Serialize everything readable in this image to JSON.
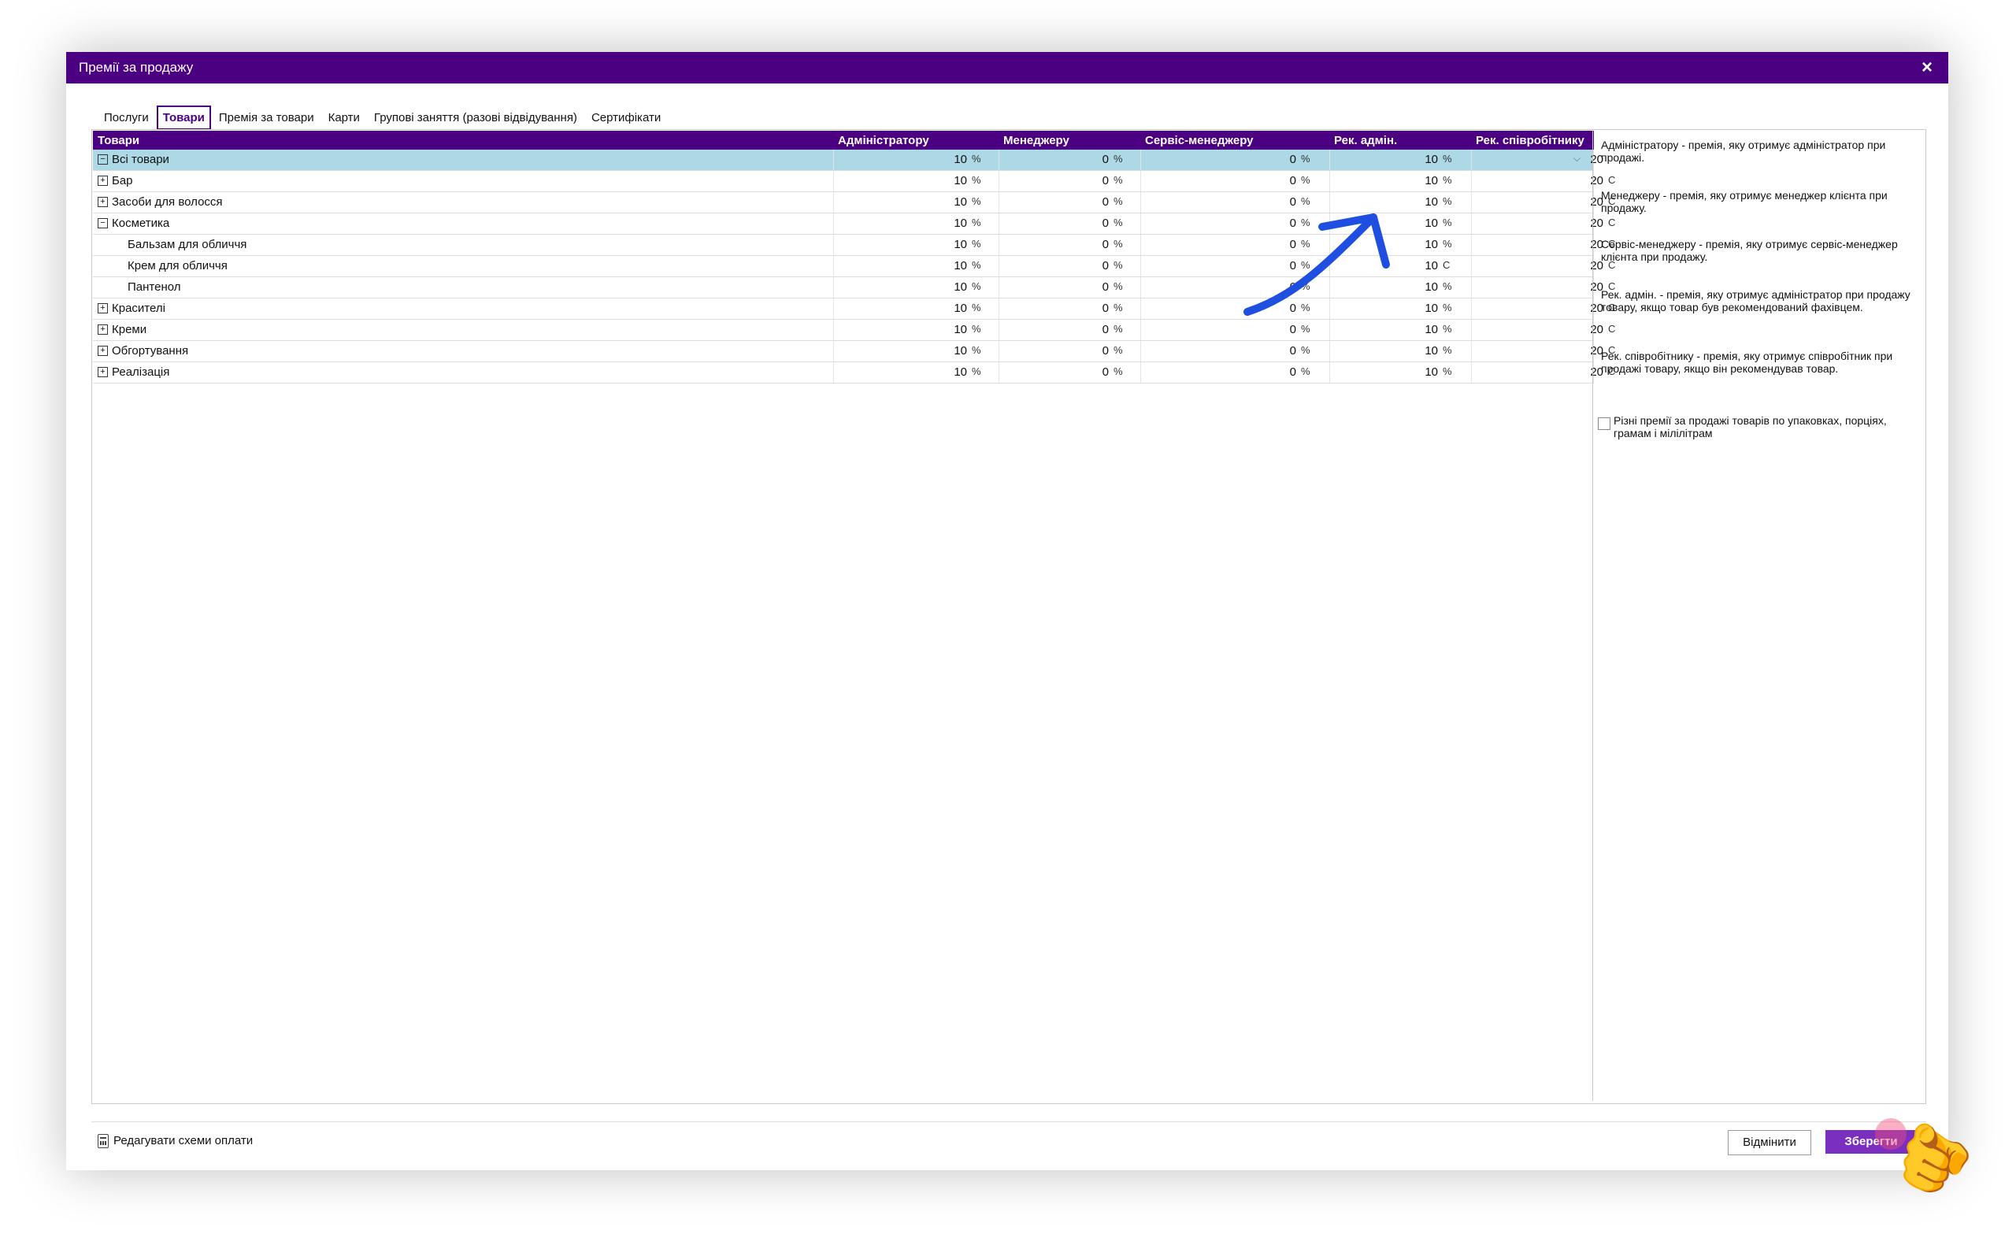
{
  "window": {
    "title": "Премії за продажу",
    "close": "×"
  },
  "tabs": [
    {
      "label": "Послуги",
      "active": false
    },
    {
      "label": "Товари",
      "active": true
    },
    {
      "label": "Премія за товари",
      "active": false
    },
    {
      "label": "Карти",
      "active": false
    },
    {
      "label": "Групові заняття (разові відвідування)",
      "active": false
    },
    {
      "label": "Сертифікати",
      "active": false
    }
  ],
  "grid": {
    "columns": {
      "name": "Товари",
      "admin": "Адміністратору",
      "manager": "Менеджеру",
      "service": "Сервіс-менеджеру",
      "rec_admin": "Рек. адмін.",
      "rec_emp": "Рек. співробітнику"
    },
    "rows": [
      {
        "name": "Всі товари",
        "expander": "⊟",
        "admin": "10",
        "admin_u": "%",
        "manager": "0",
        "manager_u": "%",
        "service": "0",
        "service_u": "%",
        "rec_admin": "10",
        "rec_admin_u": "%",
        "rec_emp": "20",
        "rec_emp_u": "",
        "selected": true
      },
      {
        "name": "Бар",
        "expander": "⊞",
        "admin": "10",
        "admin_u": "%",
        "manager": "0",
        "manager_u": "%",
        "service": "0",
        "service_u": "%",
        "rec_admin": "10",
        "rec_admin_u": "%",
        "rec_emp": "20",
        "rec_emp_u": "С"
      },
      {
        "name": "Засоби для волосся",
        "expander": "⊞",
        "admin": "10",
        "admin_u": "%",
        "manager": "0",
        "manager_u": "%",
        "service": "0",
        "service_u": "%",
        "rec_admin": "10",
        "rec_admin_u": "%",
        "rec_emp": "20",
        "rec_emp_u": "С"
      },
      {
        "name": "Косметика",
        "expander": "⊟",
        "admin": "10",
        "admin_u": "%",
        "manager": "0",
        "manager_u": "%",
        "service": "0",
        "service_u": "%",
        "rec_admin": "10",
        "rec_admin_u": "%",
        "rec_emp": "20",
        "rec_emp_u": "С"
      },
      {
        "name": "Бальзам для обличчя",
        "expander": "",
        "child": true,
        "admin": "10",
        "admin_u": "%",
        "manager": "0",
        "manager_u": "%",
        "service": "0",
        "service_u": "%",
        "rec_admin": "10",
        "rec_admin_u": "%",
        "rec_emp": "20",
        "rec_emp_u": "С"
      },
      {
        "name": "Крем для обличчя",
        "expander": "",
        "child": true,
        "admin": "10",
        "admin_u": "%",
        "manager": "0",
        "manager_u": "%",
        "service": "0",
        "service_u": "%",
        "rec_admin": "10",
        "rec_admin_u": "С",
        "rec_emp": "20",
        "rec_emp_u": "С"
      },
      {
        "name": "Пантенол",
        "expander": "",
        "child": true,
        "admin": "10",
        "admin_u": "%",
        "manager": "0",
        "manager_u": "%",
        "service": "0",
        "service_u": "%",
        "rec_admin": "10",
        "rec_admin_u": "%",
        "rec_emp": "20",
        "rec_emp_u": "С"
      },
      {
        "name": "Красителі",
        "expander": "⊞",
        "admin": "10",
        "admin_u": "%",
        "manager": "0",
        "manager_u": "%",
        "service": "0",
        "service_u": "%",
        "rec_admin": "10",
        "rec_admin_u": "%",
        "rec_emp": "20",
        "rec_emp_u": "С"
      },
      {
        "name": "Креми",
        "expander": "⊞",
        "admin": "10",
        "admin_u": "%",
        "manager": "0",
        "manager_u": "%",
        "service": "0",
        "service_u": "%",
        "rec_admin": "10",
        "rec_admin_u": "%",
        "rec_emp": "20",
        "rec_emp_u": "С"
      },
      {
        "name": "Обгортування",
        "expander": "⊞",
        "admin": "10",
        "admin_u": "%",
        "manager": "0",
        "manager_u": "%",
        "service": "0",
        "service_u": "%",
        "rec_admin": "10",
        "rec_admin_u": "%",
        "rec_emp": "20",
        "rec_emp_u": "С"
      },
      {
        "name": "Реалізація",
        "expander": "⊞",
        "admin": "10",
        "admin_u": "%",
        "manager": "0",
        "manager_u": "%",
        "service": "0",
        "service_u": "%",
        "rec_admin": "10",
        "rec_admin_u": "%",
        "rec_emp": "20",
        "rec_emp_u": "С"
      }
    ],
    "dropdown_glyph": "⌵"
  },
  "info": {
    "p1": "Адміністратору - премія, яку отримує адміністратор при продажі.",
    "p2": "Менеджеру - премія, яку отримує менеджер клієнта при продажу.",
    "p3": "Сервіс-менеджеру - премія, яку отримує сервіс-менеджер клієнта при продажу.",
    "p4": "Рек. адмін. - премія, яку отримує адміністратор при продажу товару, якщо товар був рекомендований фахівцем.",
    "p5": "Рек. співробітнику - премія, яку отримує співробітник при продажі товару, якщо він рекомендував товар.",
    "checkbox_label": "Різні премії за продажі товарів по упаковках, порціях, грамам і мілілітрам",
    "checkbox_checked": false
  },
  "footer": {
    "edit_link": "Редагувати схеми оплати",
    "cancel": "Відмінити",
    "save": "Зберегти"
  },
  "colors": {
    "accent": "#4b0082",
    "save": "#7b2fbf",
    "selected_row": "#add8e6",
    "annotation_arrow": "#1f4fe0"
  },
  "icons": {
    "hand": "pointing-hand-icon",
    "arrow": "annotation-arrow-icon",
    "calc": "calculator-icon"
  }
}
